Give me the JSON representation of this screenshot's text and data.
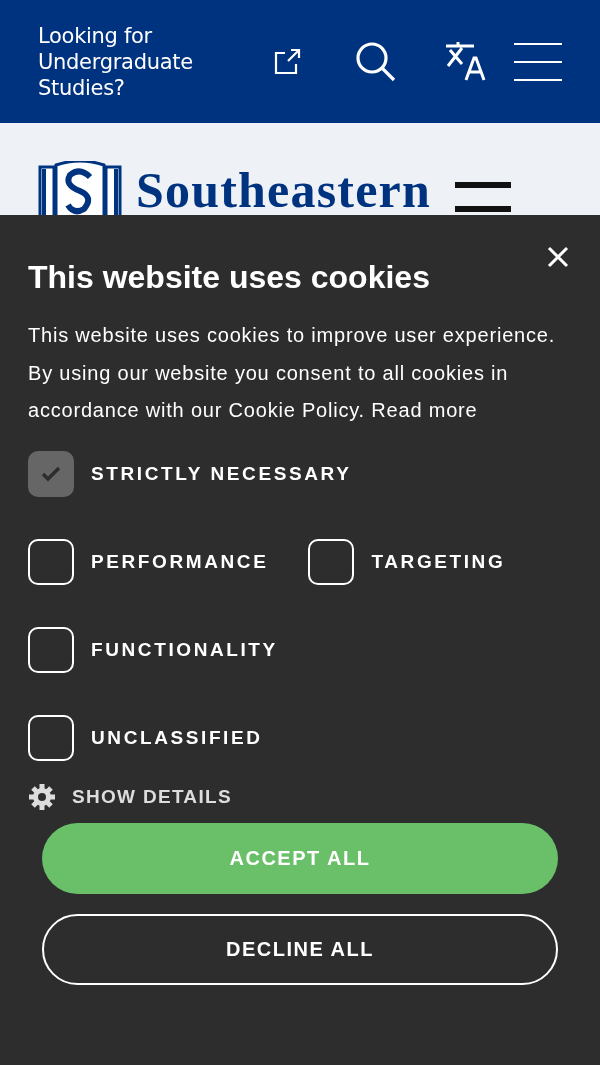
{
  "top_bar": {
    "link": "Looking for Undergraduate Studies?"
  },
  "site_header": {
    "logo_text": "Southeastern"
  },
  "cookie_banner": {
    "title": "This website uses cookies",
    "body": "This website uses cookies to improve user experience. By using our website you consent to all cookies in accordance with our Cookie Policy.",
    "read_more": "Read more",
    "categories": [
      {
        "label": "STRICTLY NECESSARY",
        "checked": true,
        "disabled": true
      },
      {
        "label": "PERFORMANCE",
        "checked": false,
        "disabled": false
      },
      {
        "label": "TARGETING",
        "checked": false,
        "disabled": false
      },
      {
        "label": "FUNCTIONALITY",
        "checked": false,
        "disabled": false
      },
      {
        "label": "UNCLASSIFIED",
        "checked": false,
        "disabled": false
      }
    ],
    "details_toggle": "SHOW DETAILS",
    "buttons": [
      {
        "label": "ACCEPT ALL",
        "kind": "primary"
      },
      {
        "label": "DECLINE ALL",
        "kind": "outline"
      }
    ]
  }
}
